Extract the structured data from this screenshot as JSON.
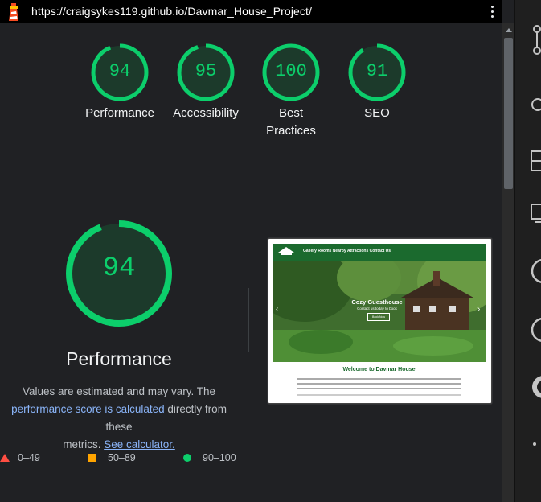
{
  "header": {
    "url": "https://craigsykes119.github.io/Davmar_House_Project/"
  },
  "gauges": [
    {
      "score": "94",
      "label": "Performance",
      "value": 0.94
    },
    {
      "score": "95",
      "label": "Accessibility",
      "value": 0.95
    },
    {
      "score": "100",
      "label": "Best Practices",
      "value": 1.0
    },
    {
      "score": "91",
      "label": "SEO",
      "value": 0.91
    }
  ],
  "performance": {
    "score": "94",
    "value": 0.94,
    "title": "Performance",
    "desc_1": "Values are estimated and may vary. The",
    "link_score": "performance score is calculated",
    "desc_2": "directly from these",
    "desc_3": "metrics.",
    "link_calc": "See calculator."
  },
  "legend": {
    "fail": "0–49",
    "average": "50–89",
    "pass": "90–100"
  },
  "colors": {
    "pass": "#0cce6b",
    "average": "#ffa400",
    "fail": "#ff4e42",
    "link": "#8ab4f8"
  },
  "screenshot": {
    "nav_links": "Gallery   Rooms   Nearby Attractions   Contact Us",
    "hero_title": "Cozy Guesthouse",
    "hero_sub": "Contact us today to book",
    "hero_button": "Book Now",
    "body_title": "Welcome to Davmar House"
  }
}
